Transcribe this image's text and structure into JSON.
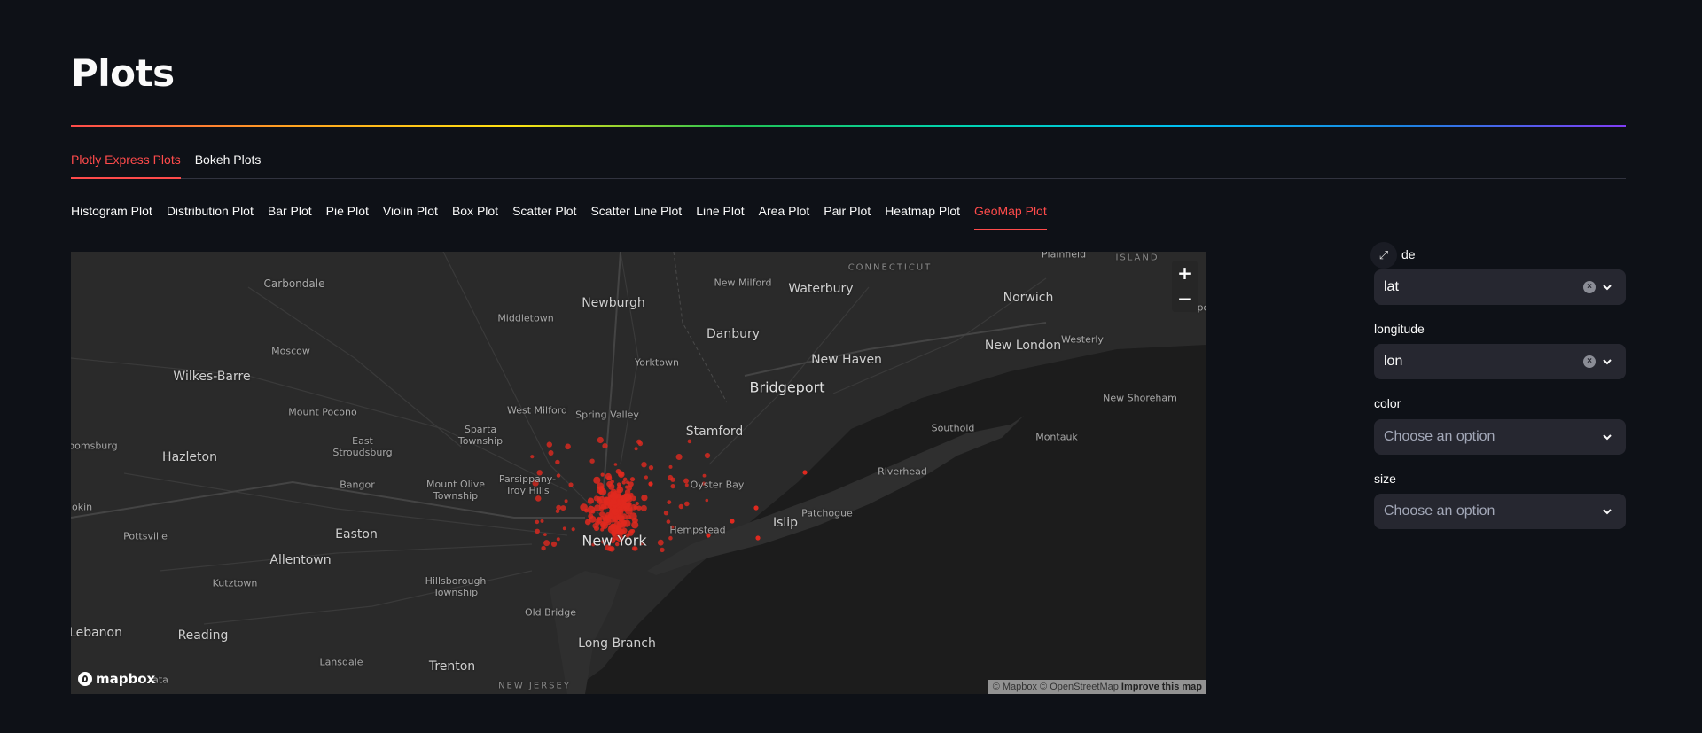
{
  "page": {
    "title": "Plots"
  },
  "main_tabs": [
    {
      "label": "Plotly Express Plots",
      "active": true
    },
    {
      "label": "Bokeh Plots",
      "active": false
    }
  ],
  "plot_tabs": [
    {
      "label": "Histogram Plot",
      "active": false
    },
    {
      "label": "Distribution Plot",
      "active": false
    },
    {
      "label": "Bar Plot",
      "active": false
    },
    {
      "label": "Pie Plot",
      "active": false
    },
    {
      "label": "Violin Plot",
      "active": false
    },
    {
      "label": "Box Plot",
      "active": false
    },
    {
      "label": "Scatter Plot",
      "active": false
    },
    {
      "label": "Scatter Line Plot",
      "active": false
    },
    {
      "label": "Line Plot",
      "active": false
    },
    {
      "label": "Area Plot",
      "active": false
    },
    {
      "label": "Pair Plot",
      "active": false
    },
    {
      "label": "Heatmap Plot",
      "active": false
    },
    {
      "label": "GeoMap Plot",
      "active": true
    }
  ],
  "map": {
    "places": [
      "CONNECTICUT",
      "Plainfield",
      "ISLAND",
      "Carbondale",
      "New Milford",
      "Waterbury",
      "Newburgh",
      "Norwich",
      "Middletown",
      "Moscow",
      "Danbury",
      "New London",
      "Westerly",
      "Wilkes-Barre",
      "Yorktown",
      "New Haven",
      "Bridgeport",
      "New Shoreham",
      "Mount Pocono",
      "West Milford",
      "Spring Valley",
      "Southold",
      "Sparta Township",
      "Stamford",
      "Montauk",
      "East Stroudsburg",
      "Hazleton",
      "Parsippany-Troy Hills",
      "Oyster Bay",
      "Riverhead",
      "Bangor",
      "Mount Olive Township",
      "Patchogue",
      "Hempstead",
      "Islip",
      "Pottsville",
      "Easton",
      "New York",
      "Allentown",
      "Kutztown",
      "Hillsborough Township",
      "Old Bridge",
      "Lebanon",
      "Reading",
      "Long Branch",
      "Lansdale",
      "Trenton",
      "NEW JERSEY",
      "oomsburg",
      "lokin",
      "ata",
      "opo"
    ],
    "zoom_in": "+",
    "zoom_out": "−",
    "logo": "mapbox",
    "attribution": "© Mapbox © OpenStreetMap",
    "improve": "Improve this map",
    "point_color": "#e0291f"
  },
  "controls": {
    "expand_icon": "⤢",
    "latitude_label_visible": "de",
    "latitude_value": "lat",
    "longitude_label": "longitude",
    "longitude_value": "lon",
    "color_label": "color",
    "color_placeholder": "Choose an option",
    "size_label": "size",
    "size_placeholder": "Choose an option",
    "clear_glyph": "×"
  },
  "colors": {
    "accent": "#ff4b4b",
    "background": "#0e1117",
    "input_bg": "#262730"
  }
}
